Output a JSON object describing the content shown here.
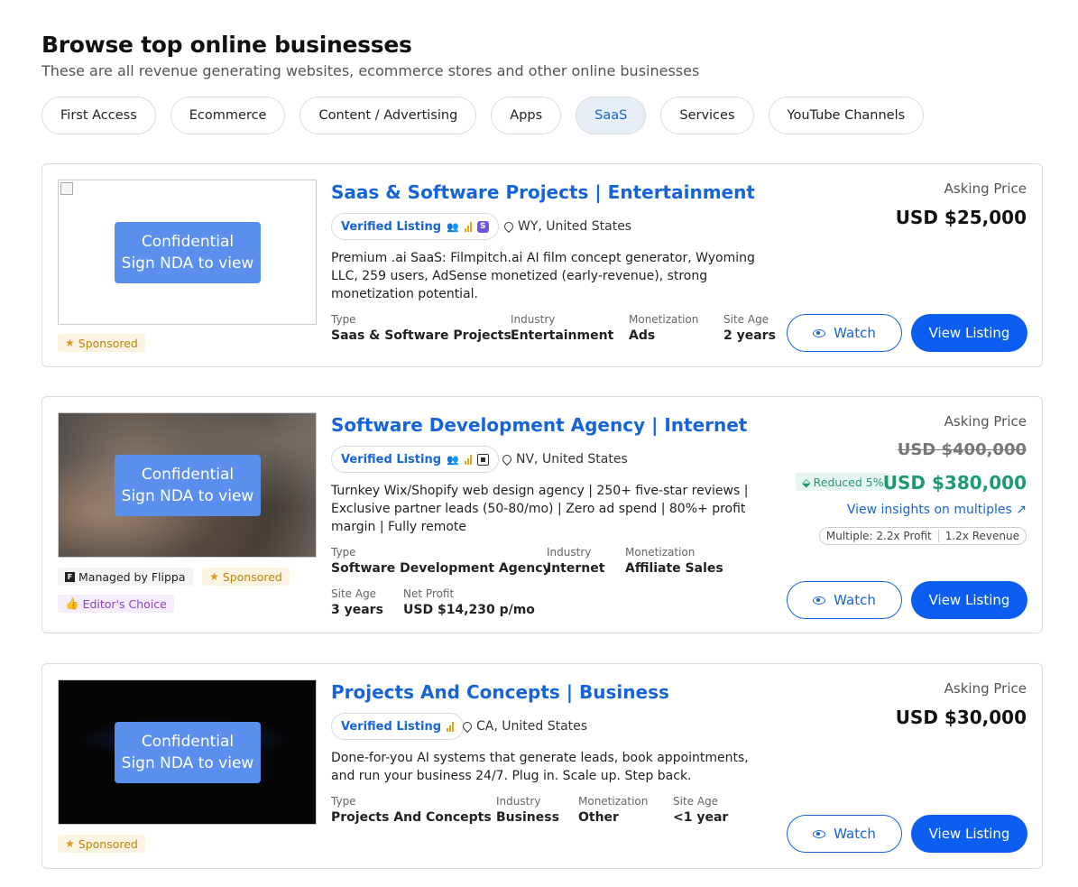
{
  "header": {
    "title": "Browse top online businesses",
    "subtitle": "These are all revenue generating websites, ecommerce stores and other online businesses"
  },
  "tabs": [
    {
      "label": "First Access"
    },
    {
      "label": "Ecommerce"
    },
    {
      "label": "Content / Advertising"
    },
    {
      "label": "Apps"
    },
    {
      "label": "SaaS",
      "active": true
    },
    {
      "label": "Services"
    },
    {
      "label": "YouTube Channels"
    }
  ],
  "common": {
    "nda_line1": "Confidential",
    "nda_line2": "Sign NDA to view",
    "verified": "Verified Listing",
    "asking_label": "Asking Price",
    "watch": "Watch",
    "view_listing": "View Listing",
    "sponsored": "Sponsored",
    "type_label": "Type",
    "industry_label": "Industry",
    "monetization_label": "Monetization",
    "site_age_label": "Site Age",
    "net_profit_label": "Net Profit"
  },
  "listings": [
    {
      "title": "Saas & Software Projects | Entertainment",
      "location": "WY, United States",
      "description": "Premium .ai SaaS: Filmpitch.ai AI film concept generator, Wyoming LLC, 259 users, AdSense monetized (early-revenue), strong monetization potential.",
      "type": "Saas & Software Projects",
      "industry": "Entertainment",
      "monetization": "Ads",
      "site_age": "2 years",
      "price": "USD $25,000"
    },
    {
      "title": "Software Development Agency | Internet",
      "location": "NV, United States",
      "description": "Turnkey Wix/Shopify web design agency | 250+ five-star reviews | Exclusive partner leads (50-80/mo) | Zero ad spend | 80%+ profit margin | Fully remote",
      "type": "Software Development Agency",
      "industry": "Internet",
      "monetization": "Affiliate Sales",
      "site_age": "3 years",
      "net_profit": "USD $14,230 p/mo",
      "old_price": "USD $400,000",
      "reduced": "Reduced 5%",
      "price": "USD $380,000",
      "insights": "View insights on multiples",
      "multiple_label": "Multiple:",
      "multiple_profit": "2.2x Profit",
      "multiple_revenue": "1.2x Revenue",
      "managed": "Managed by Flippa",
      "editors": "Editor's Choice"
    },
    {
      "title": "Projects And Concepts | Business",
      "location": "CA, United States",
      "description": "Done-for-you AI systems that generate leads, book appointments, and run your business 24/7. Plug in. Scale up. Step back.",
      "type": "Projects And Concepts",
      "industry": "Business",
      "monetization": "Other",
      "site_age": "<1 year",
      "price": "USD $30,000"
    }
  ],
  "colors": {
    "accent": "#1565d8",
    "button": "#0b5ef0",
    "green": "#1e9b6e",
    "sponsored": "#b8860b",
    "editors": "#8a3fc4"
  }
}
